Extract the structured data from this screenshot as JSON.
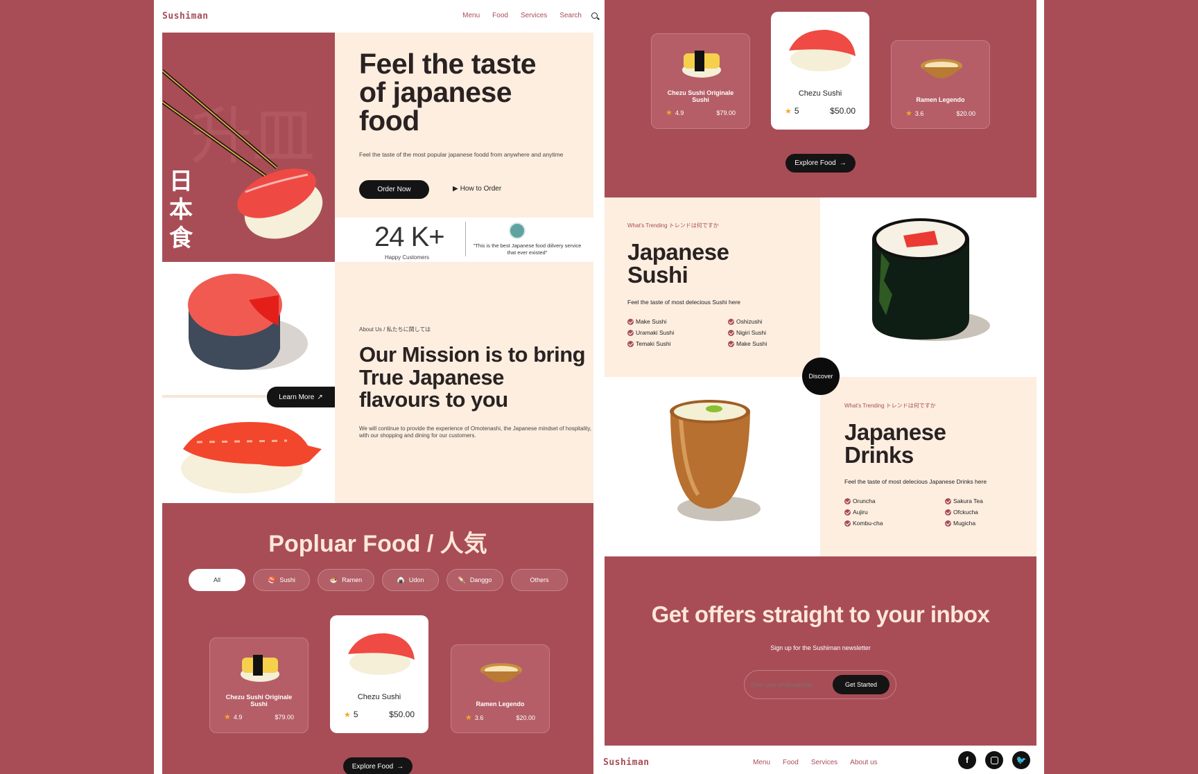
{
  "brand": {
    "logo": "Sushiman"
  },
  "nav": {
    "menu": "Menu",
    "food": "Food",
    "services": "Services",
    "search": "Search"
  },
  "hero": {
    "title": "Feel the taste of japanese food",
    "subtitle": "Feel the taste of the most popular japanese foodd from anywhere and anytime",
    "order_button": "Order Now",
    "how_button": "How to Order",
    "kanji": [
      "日",
      "本",
      "食"
    ]
  },
  "stats": {
    "count": "24 K+",
    "label": "Happy Customers",
    "quote": "\"This is the best Japanese food diilvery service that ever existed\""
  },
  "about": {
    "eyebrow": "About Us / 私たちに関しては",
    "title": "Our Mission is to bring True Japanese flavours to you",
    "body": "We will continue to provide the experience of Omotenashi, the Japanese mindset of hospitality, with our shopping and dining for our customers.",
    "learn_more": "Learn More"
  },
  "popular": {
    "title": "Popluar Food / 人気",
    "filters": [
      "All",
      "Sushi",
      "Ramen",
      "Udon",
      "Danggo",
      "Others"
    ],
    "cards": [
      {
        "name": "Chezu Sushi Originale Sushi",
        "rating": "4.9",
        "price": "$79.00"
      },
      {
        "name": "Chezu Sushi",
        "rating": "5",
        "price": "$50.00"
      },
      {
        "name": "Ramen Legendo",
        "rating": "3.6",
        "price": "$20.00"
      }
    ],
    "explore": "Explore Food"
  },
  "sushi": {
    "eyebrow": "What's Trending トレンドは何ですか",
    "title": "Japanese Sushi",
    "subtitle": "Feel the taste of most delecious Sushi here",
    "items": [
      "Make Sushi",
      "Oshizushi",
      "Uramaki Sushi",
      "Nigiri Sushi",
      "Temaki Sushi",
      "Make Sushi"
    ]
  },
  "discover": "Discover",
  "drinks": {
    "eyebrow": "What's Trending トレンドは何ですか",
    "title": "Japanese Drinks",
    "subtitle": "Feel the taste of most delecious Japanese Drinks here",
    "items": [
      "Oruncha",
      "Sakura Tea",
      "Aujiru",
      "Ofckucha",
      "Kombu-cha",
      "Mugicha"
    ]
  },
  "newsletter": {
    "title": "Get offers straight to your inbox",
    "subtitle": "Sign up for the Sushiman newsletter",
    "placeholder": "Enter your email address",
    "button": "Get Started"
  },
  "footer": {
    "menu": "Menu",
    "food": "Food",
    "services": "Services",
    "about": "About us",
    "social": [
      "f",
      "ig",
      "tw"
    ]
  },
  "colors": {
    "rose": "#a84d56",
    "cream": "#fdeee0",
    "dark": "#141414"
  }
}
